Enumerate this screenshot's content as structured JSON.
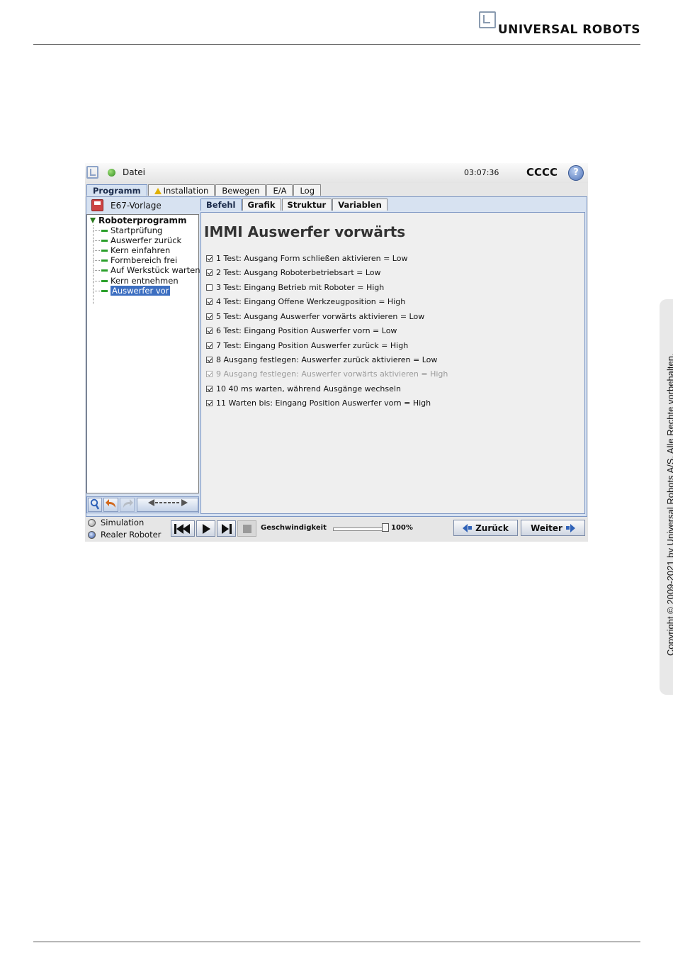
{
  "document": {
    "logo_text": "UNIVERSAL ROBOTS",
    "copyright": "Copyright © 2009-2021 by Universal Robots A/S. Alle Rechte vorbehalten."
  },
  "screen": {
    "file_menu": "Datei",
    "time": "03:07:36",
    "robot_name": "CCCC",
    "help_label": "?",
    "main_tabs": [
      {
        "label": "Programm"
      },
      {
        "label": "Installation"
      },
      {
        "label": "Bewegen"
      },
      {
        "label": "E/A"
      },
      {
        "label": "Log"
      }
    ],
    "program_name": "E67-Vorlage",
    "tree": {
      "root": "Roboterprogramm",
      "items": [
        {
          "label": "Startprüfung"
        },
        {
          "label": "Auswerfer zurück"
        },
        {
          "label": "Kern einfahren"
        },
        {
          "label": "Formbereich frei"
        },
        {
          "label": "Auf Werkstück warten"
        },
        {
          "label": "Kern entnehmen"
        },
        {
          "label": "Auswerfer vor"
        }
      ]
    },
    "sub_tabs": [
      {
        "label": "Befehl"
      },
      {
        "label": "Grafik"
      },
      {
        "label": "Struktur"
      },
      {
        "label": "Variablen"
      }
    ],
    "command": {
      "title": "IMMI Auswerfer vorwärts",
      "conditions": [
        {
          "text": "1 Test: Ausgang Form schließen aktivieren = Low",
          "checked": true
        },
        {
          "text": "2 Test: Ausgang Roboterbetriebsart = Low",
          "checked": true
        },
        {
          "text": "3 Test: Eingang Betrieb mit Roboter = High",
          "checked": false
        },
        {
          "text": "4 Test: Eingang Offene Werkzeugposition = High",
          "checked": true
        },
        {
          "text": "5 Test: Ausgang Auswerfer vorwärts aktivieren = Low",
          "checked": true
        },
        {
          "text": "6 Test: Eingang Position Auswerfer vorn = Low",
          "checked": true
        },
        {
          "text": "7 Test: Eingang Position Auswerfer zurück = High",
          "checked": true
        },
        {
          "text": "8 Ausgang festlegen: Auswerfer zurück aktivieren = Low",
          "checked": true
        },
        {
          "text": "9 Ausgang festlegen: Auswerfer vorwärts aktivieren = High",
          "checked": true,
          "disabled": true
        },
        {
          "text": "10 40 ms warten, während Ausgänge wechseln",
          "checked": true
        },
        {
          "text": "11 Warten bis: Eingang Position Auswerfer vorn = High",
          "checked": true
        }
      ]
    },
    "modes": [
      {
        "label": "Simulation"
      },
      {
        "label": "Realer Roboter"
      }
    ],
    "speed_label": "Geschwindigkeit",
    "speed_value": "100%",
    "speed_fraction": 1.0,
    "back_label": "Zurück",
    "next_label": "Weiter",
    "colors": {
      "accent": "#3d6fc1",
      "status_green": "#2f8a1d",
      "tree_node": "#2ca02c"
    }
  }
}
